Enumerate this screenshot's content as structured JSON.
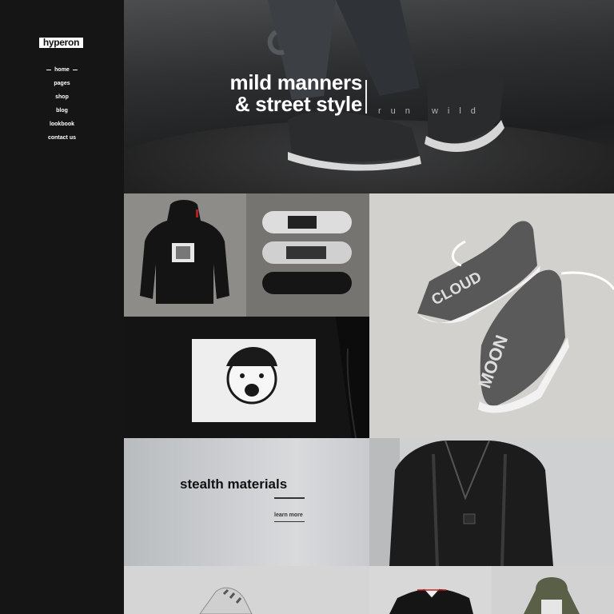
{
  "logo": "hyperon",
  "nav": [
    "home",
    "pages",
    "shop",
    "blog",
    "lookbook",
    "contact us"
  ],
  "hero": {
    "title_line1": "mild manners",
    "title_line2": "& street style",
    "subtitle": "run wild"
  },
  "promo": {
    "title": "stealth materials",
    "link": "learn more"
  },
  "products": {
    "cloud_text": "CLOUD",
    "moon_text": "MOON"
  }
}
